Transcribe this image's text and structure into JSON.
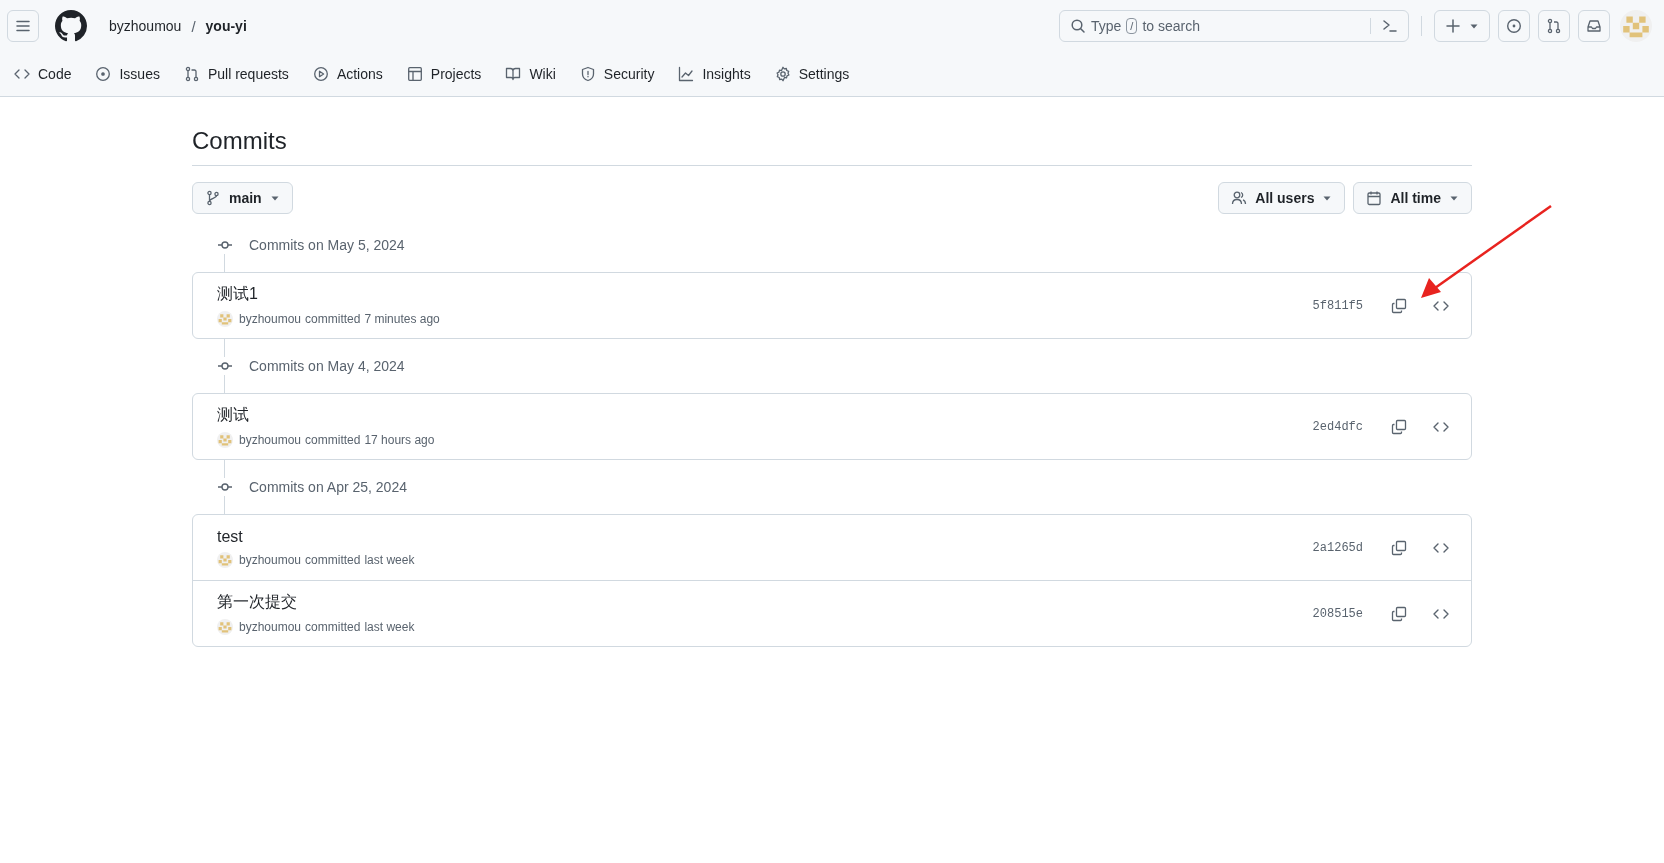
{
  "header": {
    "owner": "byzhoumou",
    "separator": "/",
    "repo": "you-yi",
    "search": {
      "placeholder_before": "Type",
      "key": "/",
      "placeholder_after": "to search"
    }
  },
  "nav": [
    {
      "label": "Code",
      "kind": "code"
    },
    {
      "label": "Issues",
      "kind": "issue"
    },
    {
      "label": "Pull requests",
      "kind": "pr"
    },
    {
      "label": "Actions",
      "kind": "play"
    },
    {
      "label": "Projects",
      "kind": "table"
    },
    {
      "label": "Wiki",
      "kind": "book"
    },
    {
      "label": "Security",
      "kind": "shield"
    },
    {
      "label": "Insights",
      "kind": "graph"
    },
    {
      "label": "Settings",
      "kind": "gear"
    }
  ],
  "page_title": "Commits",
  "branch": "main",
  "filters": [
    {
      "label": "All users",
      "kind": "people"
    },
    {
      "label": "All time",
      "kind": "calendar"
    }
  ],
  "groups": [
    {
      "date": "Commits on May 5, 2024",
      "commits": [
        {
          "message": "测试1",
          "author": "byzhoumou",
          "action": "committed",
          "time": "7 minutes ago",
          "sha": "5f811f5"
        }
      ]
    },
    {
      "date": "Commits on May 4, 2024",
      "commits": [
        {
          "message": "测试",
          "author": "byzhoumou",
          "action": "committed",
          "time": "17 hours ago",
          "sha": "2ed4dfc"
        }
      ]
    },
    {
      "date": "Commits on Apr 25, 2024",
      "commits": [
        {
          "message": "test",
          "author": "byzhoumou",
          "action": "committed",
          "time": "last week",
          "sha": "2a1265d"
        },
        {
          "message": "第一次提交",
          "author": "byzhoumou",
          "action": "committed",
          "time": "last week",
          "sha": "208515e"
        }
      ]
    }
  ]
}
